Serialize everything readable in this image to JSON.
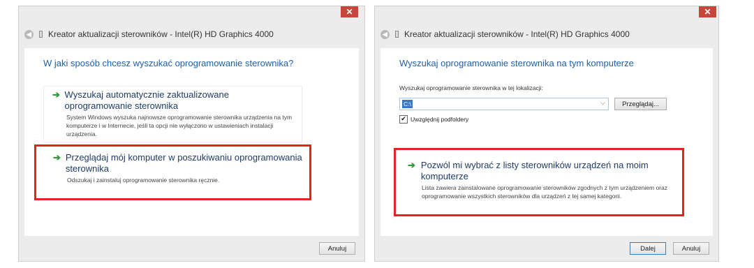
{
  "left_window": {
    "title": "Kreator aktualizacji sterowników - Intel(R) HD Graphics 4000",
    "close_label": "✕",
    "heading": "W jaki sposób chcesz wyszukać oprogramowanie sterownika?",
    "options": [
      {
        "title": "Wyszukaj automatycznie zaktualizowane oprogramowanie sterownika",
        "description": "System Windows wyszuka najnowsze oprogramowanie sterownika urządzenia na tym komputerze i w Internecie, jeśli ta opcji nie wyłączono w ustawieniach instalacji urządzenia."
      },
      {
        "title": "Przeglądaj mój komputer w poszukiwaniu oprogramowania sterownika",
        "description": "Odszukaj i zainstaluj oprogramowanie sterownika ręcznie."
      }
    ],
    "cancel_label": "Anuluj"
  },
  "right_window": {
    "title": "Kreator aktualizacji sterowników - Intel(R) HD Graphics 4000",
    "close_label": "✕",
    "heading": "Wyszukaj oprogramowanie sterownika na tym komputerze",
    "field_label": "Wyszukaj oprogramowanie sterownika w tej lokalizacji:",
    "location_value": "C:\\",
    "browse_label": "Przeglądaj...",
    "include_subfolders_label": "Uwzględnij podfoldery",
    "include_subfolders_checked": true,
    "option": {
      "title": "Pozwól mi wybrać z listy sterowników urządzeń na moim komputerze",
      "description": "Lista zawiera zainstalowane oprogramowanie sterowników zgodnych z tym urządzeniem oraz oprogramowanie wszystkich sterowników dla urządzeń z tej samej kategorii."
    },
    "next_label": "Dalej",
    "cancel_label": "Anuluj"
  },
  "colors": {
    "highlight": "#e52421",
    "heading": "#1f5fa6",
    "arrow": "#2f9a35",
    "close": "#c7463b"
  },
  "icons": {
    "back": "back-arrow-icon",
    "device": "device-icon",
    "option_arrow": "green-arrow-icon",
    "checkbox": "checkmark-icon"
  }
}
